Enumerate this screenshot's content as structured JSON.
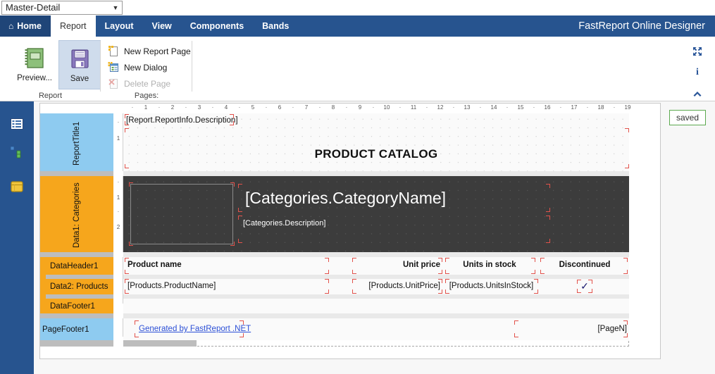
{
  "window": {
    "app_title": "FastReport Online Designer"
  },
  "report_selector": {
    "value": "Master-Detail",
    "arrow_icon": "chevron-down-icon"
  },
  "tabs": [
    {
      "label": "Home",
      "icon": "home-icon",
      "active": false,
      "is_home": true
    },
    {
      "label": "Report",
      "active": true
    },
    {
      "label": "Layout",
      "active": false
    },
    {
      "label": "View",
      "active": false
    },
    {
      "label": "Components",
      "active": false
    },
    {
      "label": "Bands",
      "active": false
    }
  ],
  "ribbon": {
    "groups": [
      {
        "name": "report",
        "label": "Report"
      },
      {
        "name": "pages",
        "label": "Pages:"
      }
    ],
    "big_buttons": [
      {
        "name": "preview",
        "label": "Preview...",
        "icon": "preview-book-icon",
        "selected": false
      },
      {
        "name": "save",
        "label": "Save",
        "icon": "floppy-disk-icon",
        "selected": true
      }
    ],
    "page_actions": [
      {
        "name": "new-report-page",
        "label": "New Report Page",
        "icon": "new-page-icon",
        "disabled": false
      },
      {
        "name": "new-dialog",
        "label": "New Dialog",
        "icon": "new-dialog-icon",
        "disabled": false
      },
      {
        "name": "delete-page",
        "label": "Delete Page",
        "icon": "delete-page-icon",
        "disabled": true
      }
    ],
    "right_icons": [
      {
        "name": "fullscreen",
        "icon": "fullscreen-icon",
        "glyph": "✥"
      },
      {
        "name": "info",
        "icon": "info-icon",
        "glyph": "i"
      },
      {
        "name": "collapse-ribbon",
        "icon": "chevron-up-icon",
        "glyph": "▲"
      }
    ]
  },
  "sidebar": {
    "items": [
      {
        "name": "properties",
        "icon": "properties-list-icon"
      },
      {
        "name": "report-tree",
        "icon": "report-tree-icon"
      },
      {
        "name": "data-sources",
        "icon": "database-icon"
      }
    ]
  },
  "status": {
    "saved_label": "saved"
  },
  "ruler": {
    "horizontal_ticks": [
      "1",
      "2",
      "3",
      "4",
      "5",
      "6",
      "7",
      "8",
      "9",
      "10",
      "11",
      "12",
      "13",
      "14",
      "15",
      "16",
      "17",
      "18",
      "19"
    ],
    "vertical_title_ticks": [
      "·",
      "1"
    ],
    "vertical_data_ticks": [
      "·",
      "1",
      "·",
      "2"
    ]
  },
  "design": {
    "bands": [
      {
        "name": "report-title",
        "label": "ReportTitle1",
        "color": "blue",
        "orientation": "vertical"
      },
      {
        "name": "data1-categories",
        "label": "Data1: Categories",
        "color": "orange",
        "orientation": "vertical"
      },
      {
        "name": "data-header",
        "label": "DataHeader1",
        "color": "orange",
        "orientation": "horizontal"
      },
      {
        "name": "data2-products",
        "label": "Data2: Products",
        "color": "orange",
        "orientation": "horizontal"
      },
      {
        "name": "data-footer",
        "label": "DataFooter1",
        "color": "orange",
        "orientation": "horizontal"
      },
      {
        "name": "page-footer",
        "label": "PageFooter1",
        "color": "blue",
        "orientation": "horizontal"
      }
    ],
    "objects": {
      "report_description": "[Report.ReportInfo.Description]",
      "report_title_text": "PRODUCT CATALOG",
      "category_name": "[Categories.CategoryName]",
      "category_description": "[Categories.Description]",
      "picture_placeholder": "category-picture-box",
      "header_product_name": "Product name",
      "header_unit_price": "Unit price",
      "header_units_in_stock": "Units in stock",
      "header_discontinued": "Discontinued",
      "data_product_name": "[Products.ProductName]",
      "data_unit_price": "[Products.UnitPrice]",
      "data_units_in_stock": "[Products.UnitsInStock]",
      "data_discontinued": "✓",
      "footer_generated_by": "Generated by FastReport .NET",
      "footer_page_number": "[PageN]"
    }
  },
  "colors": {
    "ribbon_blue": "#27548f",
    "home_tab_blue": "#1f4578",
    "band_blue": "#8ecbf0",
    "band_orange": "#f6a61c",
    "dark_band": "#3c3c3c",
    "saved_green": "#5ca94f",
    "link_blue": "#2b4fd6",
    "handle_red": "#e2524b"
  }
}
